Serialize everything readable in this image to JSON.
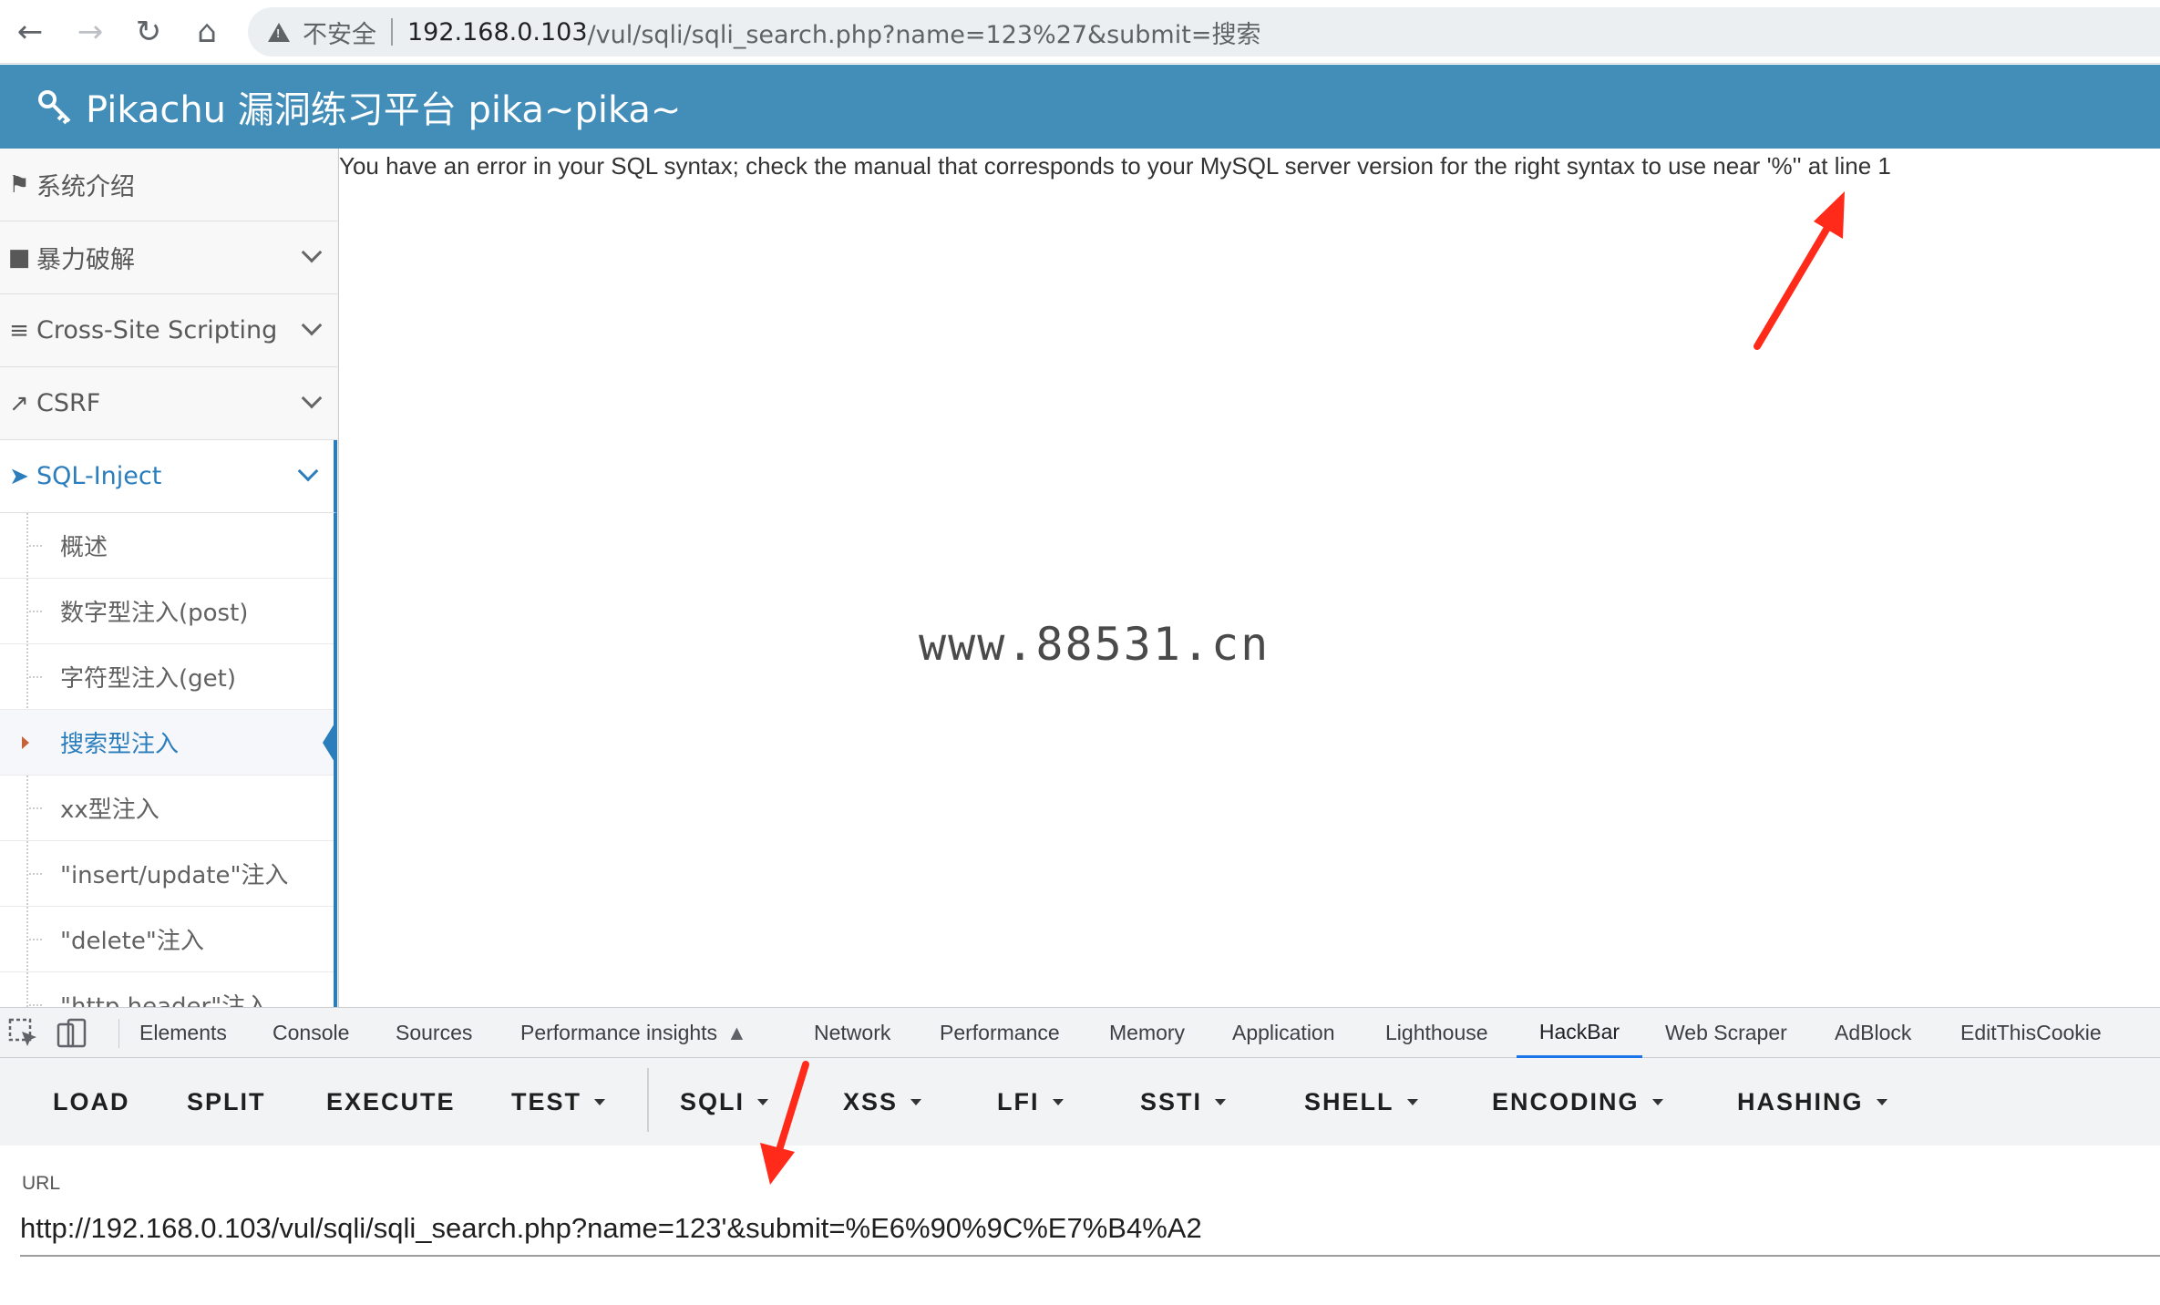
{
  "browser": {
    "security_label": "不安全",
    "url_host": "192.168.0.103",
    "url_path": "/vul/sqli/sqli_search.php?name=123%27&submit=搜索"
  },
  "app": {
    "title": "Pikachu 漏洞练习平台 pika~pika~"
  },
  "sidebar": {
    "items": [
      {
        "label": "系统介绍",
        "icon": "tag-icon"
      },
      {
        "label": "暴力破解",
        "icon": "lock-icon"
      },
      {
        "label": "Cross-Site Scripting",
        "icon": "sitemap-icon"
      },
      {
        "label": "CSRF",
        "icon": "share-icon"
      },
      {
        "label": "SQL-Inject",
        "icon": "fighter-jet-icon"
      }
    ],
    "submenu": [
      {
        "label": "概述"
      },
      {
        "label": "数字型注入(post)"
      },
      {
        "label": "字符型注入(get)"
      },
      {
        "label": "搜索型注入"
      },
      {
        "label": "xx型注入"
      },
      {
        "label": "\"insert/update\"注入"
      },
      {
        "label": "\"delete\"注入"
      },
      {
        "label": "\"http header\"注入"
      }
    ]
  },
  "main": {
    "error_message": "You have an error in your SQL syntax; check the manual that corresponds to your MySQL server version for the right syntax to use near '%'' at line 1",
    "watermark": "www.88531.cn"
  },
  "devtools": {
    "tabs": [
      "Elements",
      "Console",
      "Sources",
      "Performance insights",
      "Network",
      "Performance",
      "Memory",
      "Application",
      "Lighthouse",
      "HackBar",
      "Web Scraper",
      "AdBlock",
      "EditThisCookie"
    ],
    "active_tab": "HackBar"
  },
  "hackbar": {
    "buttons": [
      "LOAD",
      "SPLIT",
      "EXECUTE",
      "TEST",
      "SQLI",
      "XSS",
      "LFI",
      "SSTI",
      "SHELL",
      "ENCODING",
      "HASHING"
    ],
    "url_label": "URL",
    "url_value": "http://192.168.0.103/vul/sqli/sqli_search.php?name=123'&submit=%E6%90%9C%E7%B4%A2"
  },
  "colors": {
    "header_bg": "#438eb9",
    "active_blue": "#2b7dbc",
    "annotation_arrow": "#ff2a1a"
  }
}
